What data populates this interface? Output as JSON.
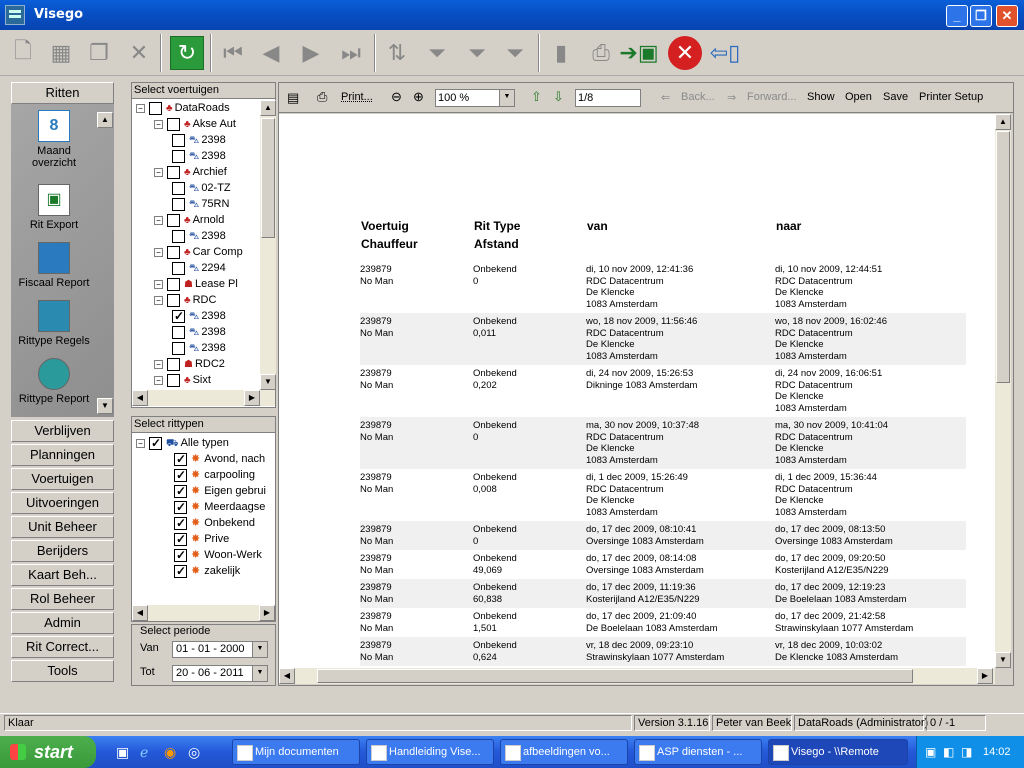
{
  "window": {
    "title": "Visego"
  },
  "toolbar": {
    "icons": [
      "new-doc-icon",
      "grid-icon",
      "copy-icon",
      "delete-icon",
      "refresh-icon",
      "first-icon",
      "prev-icon",
      "next-icon",
      "last-icon",
      "sort-icon",
      "filter-icon",
      "filter-add-icon",
      "filter-clear-icon",
      "page-icon",
      "print-icon",
      "excel-export-icon",
      "close-red-icon",
      "exit-door-icon"
    ]
  },
  "nav": {
    "ritten": "Ritten",
    "items": [
      {
        "label": "Maand\noverzicht",
        "icon": "calendar-icon"
      },
      {
        "label": "Rit Export",
        "icon": "excel-icon"
      },
      {
        "label": "Fiscaal Report",
        "icon": "report-icon"
      },
      {
        "label": "Rittype Regels",
        "icon": "rules-icon"
      },
      {
        "label": "Rittype Report",
        "icon": "rittype-report-icon"
      }
    ],
    "sections": [
      "Verblijven",
      "Planningen",
      "Voertuigen",
      "Uitvoeringen",
      "Unit Beheer",
      "Berijders",
      "Kaart Beh...",
      "Rol Beheer",
      "Admin",
      "Rit Correct...",
      "Tools"
    ]
  },
  "voertuigen": {
    "header": "Select voertuigen",
    "rows": [
      {
        "label": "DataRoads",
        "level": 0,
        "type": "group",
        "expanded": true,
        "checked": false
      },
      {
        "label": "Akse Aut",
        "level": 1,
        "type": "group",
        "checked": false
      },
      {
        "label": "2398",
        "level": 2,
        "type": "car",
        "checked": false
      },
      {
        "label": "2398",
        "level": 2,
        "type": "car",
        "checked": false
      },
      {
        "label": "Archief",
        "level": 1,
        "type": "group",
        "checked": false
      },
      {
        "label": "02-TZ",
        "level": 2,
        "type": "car",
        "checked": false
      },
      {
        "label": "75RN",
        "level": 2,
        "type": "car",
        "checked": false
      },
      {
        "label": "Arnold",
        "level": 1,
        "type": "group",
        "checked": false
      },
      {
        "label": "2398",
        "level": 2,
        "type": "car",
        "checked": false
      },
      {
        "label": "Car Comp",
        "level": 1,
        "type": "group",
        "checked": false
      },
      {
        "label": "2294",
        "level": 2,
        "type": "car",
        "checked": false
      },
      {
        "label": "Lease Pl",
        "level": 1,
        "type": "person",
        "checked": false
      },
      {
        "label": "RDC",
        "level": 1,
        "type": "group",
        "checked": false
      },
      {
        "label": "2398",
        "level": 2,
        "type": "car",
        "checked": true
      },
      {
        "label": "2398",
        "level": 2,
        "type": "car",
        "checked": false
      },
      {
        "label": "2398",
        "level": 2,
        "type": "car",
        "checked": false
      },
      {
        "label": "RDC2",
        "level": 1,
        "type": "person",
        "checked": false
      },
      {
        "label": "Sixt",
        "level": 1,
        "type": "group",
        "checked": false
      }
    ]
  },
  "rittypen": {
    "header": "Select rittypen",
    "root": "Alle typen",
    "items": [
      "Avond, nach",
      "carpooling",
      "Eigen gebrui",
      "Meerdaagse",
      "Onbekend",
      "Prive",
      "Woon-Werk",
      "zakelijk"
    ]
  },
  "periode": {
    "header": "Select periode",
    "van_label": "Van",
    "van": "01 - 01 - 2000",
    "tot_label": "Tot",
    "tot": "20 - 06 - 2011"
  },
  "viewer": {
    "print": "Print...",
    "zoom": "100 %",
    "page": "1/8",
    "back": "Back...",
    "forward": "Forward...",
    "show": "Show",
    "open": "Open",
    "save": "Save",
    "printer_setup": "Printer Setup"
  },
  "report": {
    "headers": {
      "col1a": "Voertuig",
      "col1b": "Chauffeur",
      "col2a": "Rit Type",
      "col2b": "Afstand",
      "col3": "van",
      "col4": "naar"
    },
    "rows": [
      {
        "voertuig": "239879",
        "chauffeur": "No Man",
        "type": "Onbekend",
        "afstand": "0",
        "van_tijd": "di, 10 nov 2009, 12:41:36",
        "van": [
          "RDC Datacentrum",
          "De Klencke",
          "1083 Amsterdam"
        ],
        "naar_tijd": "di, 10 nov 2009, 12:44:51",
        "naar": [
          "RDC Datacentrum",
          "De Klencke",
          "1083 Amsterdam"
        ]
      },
      {
        "voertuig": "239879",
        "chauffeur": "No Man",
        "type": "Onbekend",
        "afstand": "0,011",
        "van_tijd": "wo, 18 nov 2009, 11:56:46",
        "van": [
          "RDC Datacentrum",
          "De Klencke",
          "1083 Amsterdam"
        ],
        "naar_tijd": "wo, 18 nov 2009, 16:02:46",
        "naar": [
          "RDC Datacentrum",
          "De Klencke",
          "1083 Amsterdam"
        ]
      },
      {
        "voertuig": "239879",
        "chauffeur": "No Man",
        "type": "Onbekend",
        "afstand": "0,202",
        "van_tijd": "di, 24 nov 2009, 15:26:53",
        "van": [
          "Dikninge 1083 Amsterdam"
        ],
        "naar_tijd": "di, 24 nov 2009, 16:06:51",
        "naar": [
          "RDC Datacentrum",
          "De Klencke",
          "1083 Amsterdam"
        ]
      },
      {
        "voertuig": "239879",
        "chauffeur": "No Man",
        "type": "Onbekend",
        "afstand": "0",
        "van_tijd": "ma, 30 nov 2009, 10:37:48",
        "van": [
          "RDC Datacentrum",
          "De Klencke",
          "1083 Amsterdam"
        ],
        "naar_tijd": "ma, 30 nov 2009, 10:41:04",
        "naar": [
          "RDC Datacentrum",
          "De Klencke",
          "1083 Amsterdam"
        ]
      },
      {
        "voertuig": "239879",
        "chauffeur": "No Man",
        "type": "Onbekend",
        "afstand": "0,008",
        "van_tijd": "di, 1 dec 2009, 15:26:49",
        "van": [
          "RDC Datacentrum",
          "De Klencke",
          "1083 Amsterdam"
        ],
        "naar_tijd": "di, 1 dec 2009, 15:36:44",
        "naar": [
          "RDC Datacentrum",
          "De Klencke",
          "1083 Amsterdam"
        ]
      },
      {
        "voertuig": "239879",
        "chauffeur": "No Man",
        "type": "Onbekend",
        "afstand": "0",
        "van_tijd": "do, 17 dec 2009, 08:10:41",
        "van": [
          "Oversinge 1083 Amsterdam"
        ],
        "naar_tijd": "do, 17 dec 2009, 08:13:50",
        "naar": [
          "Oversinge 1083 Amsterdam"
        ]
      },
      {
        "voertuig": "239879",
        "chauffeur": "No Man",
        "type": "Onbekend",
        "afstand": "49,069",
        "van_tijd": "do, 17 dec 2009, 08:14:08",
        "van": [
          "Oversinge 1083 Amsterdam"
        ],
        "naar_tijd": "do, 17 dec 2009, 09:20:50",
        "naar": [
          "Kosterijland A12/E35/N229"
        ]
      },
      {
        "voertuig": "239879",
        "chauffeur": "No Man",
        "type": "Onbekend",
        "afstand": "60,838",
        "van_tijd": "do, 17 dec 2009, 11:19:36",
        "van": [
          "Kosterijland A12/E35/N229"
        ],
        "naar_tijd": "do, 17 dec 2009, 12:19:23",
        "naar": [
          "De Boelelaan 1083 Amsterdam"
        ]
      },
      {
        "voertuig": "239879",
        "chauffeur": "No Man",
        "type": "Onbekend",
        "afstand": "1,501",
        "van_tijd": "do, 17 dec 2009, 21:09:40",
        "van": [
          "De Boelelaan 1083 Amsterdam"
        ],
        "naar_tijd": "do, 17 dec 2009, 21:42:58",
        "naar": [
          "Strawinskylaan 1077 Amsterdam"
        ]
      },
      {
        "voertuig": "239879",
        "chauffeur": "No Man",
        "type": "Onbekend",
        "afstand": "0,624",
        "van_tijd": "vr, 18 dec 2009, 09:23:10",
        "van": [
          "Strawinskylaan 1077 Amsterdam"
        ],
        "naar_tijd": "vr, 18 dec 2009, 10:03:02",
        "naar": [
          "De Klencke 1083 Amsterdam"
        ]
      }
    ]
  },
  "status": {
    "text": "Klaar",
    "version": "Version 3.1.16",
    "user": "Peter van Beek",
    "org": "DataRoads (Administrator)",
    "count": "0 / -1"
  },
  "taskbar": {
    "start": "start",
    "tasks": [
      "Mijn documenten",
      "Handleiding Vise...",
      "afbeeldingen vo...",
      "ASP diensten - ...",
      "Visego - \\\\Remote"
    ],
    "clock": "14:02"
  }
}
